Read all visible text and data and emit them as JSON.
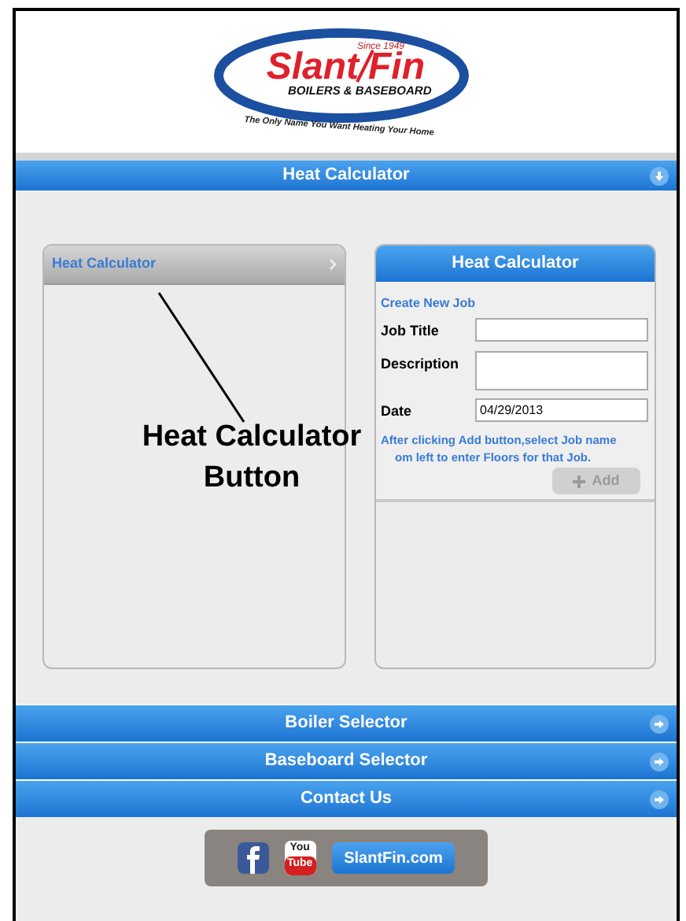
{
  "logo": {
    "since": "Since 1949",
    "brand_left": "Slant",
    "brand_right": "Fin",
    "subtitle": "BOILERS & BASEBOARD",
    "tagline": "The Only Name You Want Heating Your Home"
  },
  "top_bar": {
    "label": "Heat Calculator"
  },
  "sidebar": {
    "items": [
      {
        "label": "Heat Calculator",
        "selected": true
      }
    ]
  },
  "form": {
    "title": "Heat Calculator",
    "section": "Create New Job",
    "fields": [
      {
        "label": "Job Title",
        "kind": "single"
      },
      {
        "label": "Description",
        "kind": "multi"
      },
      {
        "label": "Date",
        "value": "04/29/2013",
        "kind": "single"
      }
    ],
    "hint_lines": [
      "After clicking Add button,select Job name",
      "om left to enter Floors for that Job."
    ],
    "add_button": {
      "label": "Add",
      "disabled": true
    }
  },
  "callout": {
    "text": "Heat Calculator Button"
  },
  "nav_bars": [
    {
      "label": "Boiler Selector"
    },
    {
      "label": "Baseboard Selector"
    },
    {
      "label": "Contact Us"
    }
  ],
  "footer": {
    "youtube_top": "You",
    "youtube_bottom": "Tube",
    "website_button": "SlantFin.com"
  }
}
